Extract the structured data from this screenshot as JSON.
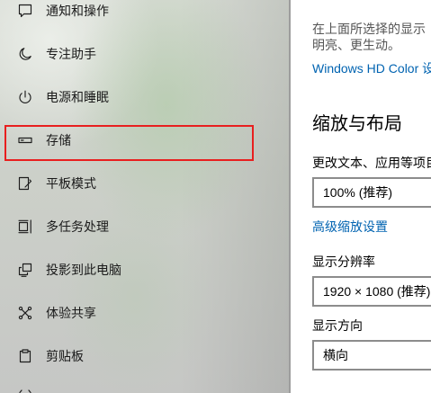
{
  "sidebar": {
    "items": [
      {
        "label": "通知和操作",
        "icon": "notification-icon"
      },
      {
        "label": "专注助手",
        "icon": "moon-icon"
      },
      {
        "label": "电源和睡眠",
        "icon": "power-icon"
      },
      {
        "label": "存储",
        "icon": "storage-icon",
        "highlighted": true
      },
      {
        "label": "平板模式",
        "icon": "tablet-mode-icon"
      },
      {
        "label": "多任务处理",
        "icon": "multitasking-icon"
      },
      {
        "label": "投影到此电脑",
        "icon": "project-icon"
      },
      {
        "label": "体验共享",
        "icon": "shared-experiences-icon"
      },
      {
        "label": "剪贴板",
        "icon": "clipboard-icon"
      }
    ]
  },
  "content": {
    "hd_color": {
      "description_line1": "在上面所选择的显示",
      "description_line2": "明亮、更生动。",
      "link": "Windows HD Color 设"
    },
    "scale_layout": {
      "heading": "缩放与布局",
      "scale_label": "更改文本、应用等项目",
      "scale_value": "100% (推荐)",
      "advanced_link": "高级缩放设置",
      "resolution_label": "显示分辨率",
      "resolution_value": "1920 × 1080 (推荐)",
      "orientation_label": "显示方向",
      "orientation_value": "横向"
    }
  },
  "colors": {
    "link": "#0063b1",
    "highlight": "#e81f1f"
  }
}
